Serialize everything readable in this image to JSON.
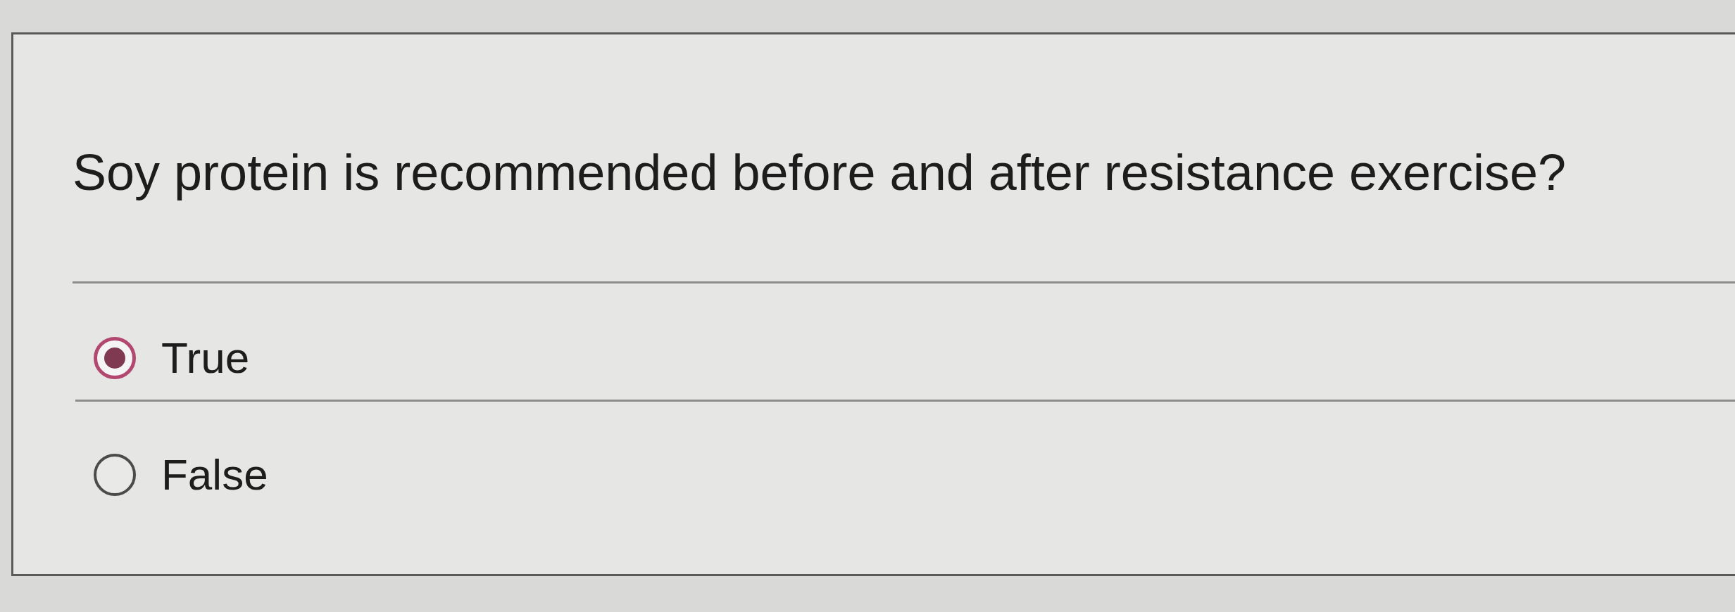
{
  "question": {
    "text": "Soy protein is recommended before and after resistance exercise?"
  },
  "options": [
    {
      "label": "True",
      "selected": true
    },
    {
      "label": "False",
      "selected": false
    }
  ]
}
